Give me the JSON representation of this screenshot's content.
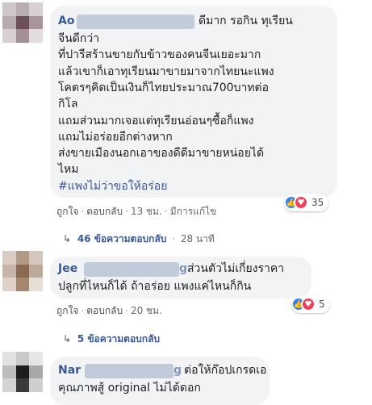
{
  "comments": [
    {
      "author": "Ao",
      "lines": [
        "ดีมาก รอกิน ทุเรียน",
        "จีนดีกว่า",
        "ที่ปารีสร้านขายกับข้าวของคนจีนเยอะมาก",
        "แล้วเขาก็เอาทุเรียนมาขายมาจากไทยนะแพง",
        "โคตรๆคิดเป็นเงินก็ไทยประมาณ700บาทต่อ",
        "กิโล",
        "แถมส่วนมากเจอแต่ทุเรียนอ่อนๆซื้อก็แพง",
        "แถมไม่อร่อยอีกต่างหาก",
        "ส่งขายเมืองนอกเอาของดีดีมาขายหน่อยได้",
        "ไหม"
      ],
      "hashtag": "#แพงไม่ว่าขอให้อร่อย",
      "like_label": "ถูกใจ",
      "reply_label": "ตอบกลับ",
      "time": "13 ชม.",
      "edited": "มีการแก้ไข",
      "reaction_count": "35",
      "replies_text": "46 ข้อความตอบกลับ",
      "replies_time": "28 นาที"
    },
    {
      "author": "Jee",
      "author_tail": "g",
      "lines": [
        "ส่วนตัวไม่เกี่ยงราคา",
        "ปลูกที่ไหนก็ได้ ถ้าอร่อย แพงแค่ไหนก็กิน"
      ],
      "like_label": "ถูกใจ",
      "reply_label": "ตอบกลับ",
      "time": "20 ชม.",
      "reaction_count": "5",
      "replies_text": "5 ข้อความตอบกลับ"
    },
    {
      "author": "Nar",
      "author_tail": "g",
      "lines": [
        "ต่อให้ก๊อปเกรดเอ",
        "คุณภาพสู้ original ไม่ได้ดอก"
      ]
    }
  ],
  "icons": {
    "like": "thumbs-up-icon",
    "love": "heart-icon",
    "reply_arrow": "reply-arrow-icon"
  },
  "colors": {
    "name": "#385898",
    "bubble": "#f2f3f5",
    "like": "#2e81f4",
    "love": "#f33e58"
  }
}
